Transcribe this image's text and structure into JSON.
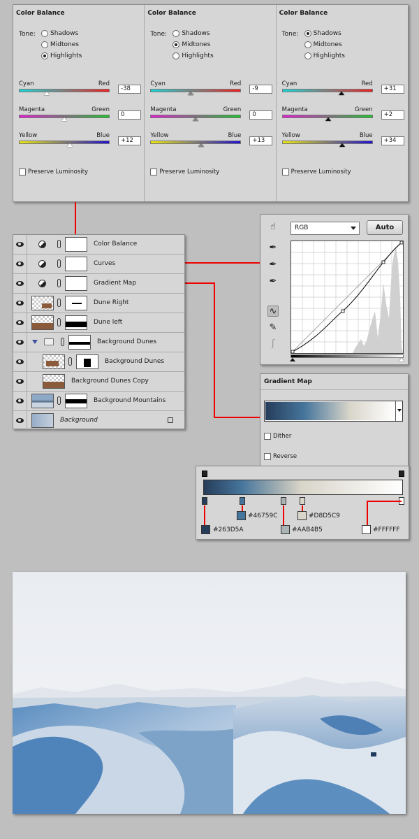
{
  "color_balance": {
    "panels": [
      {
        "title": "Color Balance",
        "tone_label": "Tone:",
        "tones": [
          {
            "label": "Shadows",
            "selected": false
          },
          {
            "label": "Midtones",
            "selected": false
          },
          {
            "label": "Highlights",
            "selected": true
          }
        ],
        "sliders": [
          {
            "left": "Cyan",
            "right": "Red",
            "value": "-38"
          },
          {
            "left": "Magenta",
            "right": "Green",
            "value": "0"
          },
          {
            "left": "Yellow",
            "right": "Blue",
            "value": "+12"
          }
        ],
        "preserve_luminosity": "Preserve Luminosity"
      },
      {
        "title": "Color Balance",
        "tone_label": "Tone:",
        "tones": [
          {
            "label": "Shadows",
            "selected": false
          },
          {
            "label": "Midtones",
            "selected": true
          },
          {
            "label": "Highlights",
            "selected": false
          }
        ],
        "sliders": [
          {
            "left": "Cyan",
            "right": "Red",
            "value": "-9"
          },
          {
            "left": "Magenta",
            "right": "Green",
            "value": "0"
          },
          {
            "left": "Yellow",
            "right": "Blue",
            "value": "+13"
          }
        ],
        "preserve_luminosity": "Preserve Luminosity"
      },
      {
        "title": "Color Balance",
        "tone_label": "Tone:",
        "tones": [
          {
            "label": "Shadows",
            "selected": true
          },
          {
            "label": "Midtones",
            "selected": false
          },
          {
            "label": "Highlights",
            "selected": false
          }
        ],
        "sliders": [
          {
            "left": "Cyan",
            "right": "Red",
            "value": "+31"
          },
          {
            "left": "Magenta",
            "right": "Green",
            "value": "+2"
          },
          {
            "left": "Yellow",
            "right": "Blue",
            "value": "+34"
          }
        ],
        "preserve_luminosity": "Preserve Luminosity"
      }
    ]
  },
  "layers": [
    {
      "name": "Color Balance",
      "kind": "adjustment"
    },
    {
      "name": "Curves",
      "kind": "adjustment"
    },
    {
      "name": "Gradient Map",
      "kind": "adjustment"
    },
    {
      "name": "Dune Right",
      "kind": "image"
    },
    {
      "name": "Dune left",
      "kind": "image"
    },
    {
      "name": "Background Dunes",
      "kind": "group"
    },
    {
      "name": "Background Dunes",
      "kind": "smart"
    },
    {
      "name": "Background Dunes Copy",
      "kind": "smart"
    },
    {
      "name": "Background Mountains",
      "kind": "image"
    },
    {
      "name": "Background",
      "kind": "background"
    }
  ],
  "curves": {
    "channel": "RGB",
    "auto_label": "Auto"
  },
  "gradient_map": {
    "title": "Gradient Map",
    "dither_label": "Dither",
    "reverse_label": "Reverse"
  },
  "gradient_stops": [
    {
      "hex": "#263D5A",
      "label": "#263D5A",
      "location": 0
    },
    {
      "hex": "#46759C",
      "label": "#46759C",
      "location": 19
    },
    {
      "hex": "#AAB4B5",
      "label": "#AAB4B5",
      "location": 39
    },
    {
      "hex": "#D8D5C9",
      "label": "#D8D5C9",
      "location": 49
    },
    {
      "hex": "#FFFFFF",
      "label": "#FFFFFF",
      "location": 100
    }
  ],
  "accent_color": "#e00000"
}
